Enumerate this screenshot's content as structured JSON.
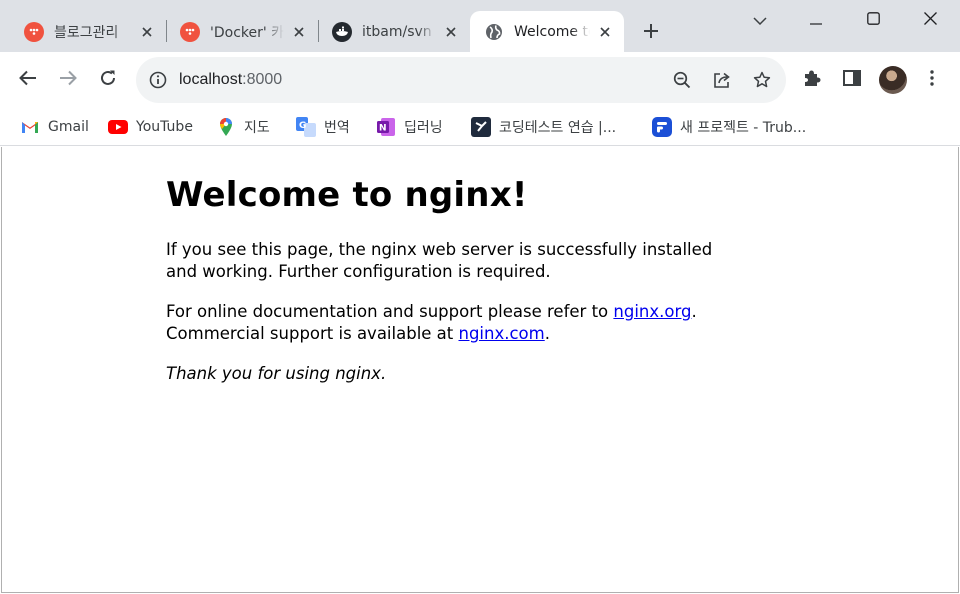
{
  "tabs": [
    {
      "title": "블로그관리",
      "favicon": "tistory-icon",
      "color": "#f0523f"
    },
    {
      "title": "'Docker' 카",
      "favicon": "tistory-icon",
      "color": "#f0523f"
    },
    {
      "title": "itbam/svn",
      "favicon": "docker-icon",
      "color": "#24292f"
    },
    {
      "title": "Welcome to nginx!",
      "favicon": "globe-icon",
      "color": "#5f6368"
    }
  ],
  "omnibox": {
    "host": "localhost",
    "port": ":8000"
  },
  "bookmarks": [
    {
      "label": "Gmail",
      "icon": "gmail-icon"
    },
    {
      "label": "YouTube",
      "icon": "youtube-icon"
    },
    {
      "label": "지도",
      "icon": "maps-icon"
    },
    {
      "label": "번역",
      "icon": "translate-icon"
    },
    {
      "label": "딥러닝",
      "icon": "onenote-icon"
    },
    {
      "label": "코딩테스트 연습 |...",
      "icon": "programmers-icon"
    },
    {
      "label": "새 프로젝트 - Trub...",
      "icon": "trubrain-icon"
    }
  ],
  "page": {
    "heading": "Welcome to nginx!",
    "para1": "If you see this page, the nginx web server is successfully installed and working. Further configuration is required.",
    "para2_prefix": "For online documentation and support please refer to ",
    "link1": "nginx.org",
    "para2_mid": ".",
    "para2_line2": "Commercial support is available at ",
    "link2": "nginx.com",
    "para2_end": ".",
    "thanks": "Thank you for using nginx."
  },
  "colors": {
    "tabstrip": "#dee1e6",
    "link": "#0000ee",
    "tistory": "#f0523f",
    "youtube": "#ff0000"
  }
}
